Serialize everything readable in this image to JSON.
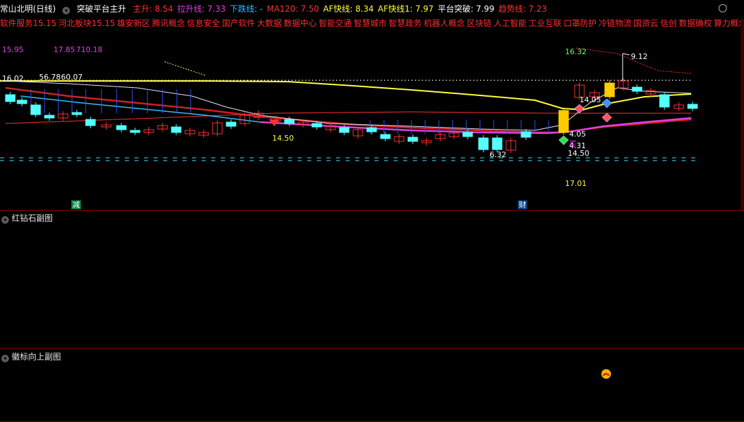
{
  "legend": {
    "title": "常山北明(日线)",
    "indicator": "突破平台主升",
    "items": [
      {
        "label": "主升: 8.54",
        "color": "#ff3030"
      },
      {
        "label": "拉升线: 7.33",
        "color": "#e040e0"
      },
      {
        "label": "下跌线: -",
        "color": "#30c0ff"
      },
      {
        "label": "MA120: 7.50",
        "color": "#ff3030"
      },
      {
        "label": "AF快线: 8.34",
        "color": "#ffff40"
      },
      {
        "label": "AF快线1: 7.97",
        "color": "#ffff40"
      },
      {
        "label": "平台突破: 7.99",
        "color": "#ffffff"
      },
      {
        "label": "趋势线: 7.23",
        "color": "#ff3030"
      }
    ]
  },
  "concepts": [
    "软件服务15.15",
    "河北板块15.15",
    "雄安新区",
    "腾讯概念",
    "信息安全",
    "国产软件",
    "大数据",
    "数据中心",
    "智能交通",
    "智慧城市",
    "智慧政务",
    "机器人概念",
    "区块链",
    "人工智能",
    "工业互联",
    "口罩防护",
    "冷链物流",
    "国资云",
    "信创",
    "数据确权",
    "算力概念"
  ],
  "price_labels": {
    "tl1": "15.95",
    "tl2": "17.85",
    "tl3": "710.18",
    "ml1": "16.02",
    "ml2": "56.78",
    "ml3": "60.07",
    "mid": "14.50",
    "g": "16.32",
    "h": "9.12",
    "r1": "14.05",
    "r2": "4.05",
    "r3": "4.31",
    "r4": "14.50",
    "low": "6.32",
    "bot": "17.01"
  },
  "tags": {
    "left": "减",
    "right": "财",
    "buy": "买"
  },
  "panes": {
    "p2": "红钻石副图",
    "p3": "徽标向上副图"
  },
  "colors": {
    "up": "#ff3030",
    "down": "#55ffff",
    "yellow": "#ffff40",
    "magenta": "#e040e0",
    "white": "#ffffff"
  }
}
